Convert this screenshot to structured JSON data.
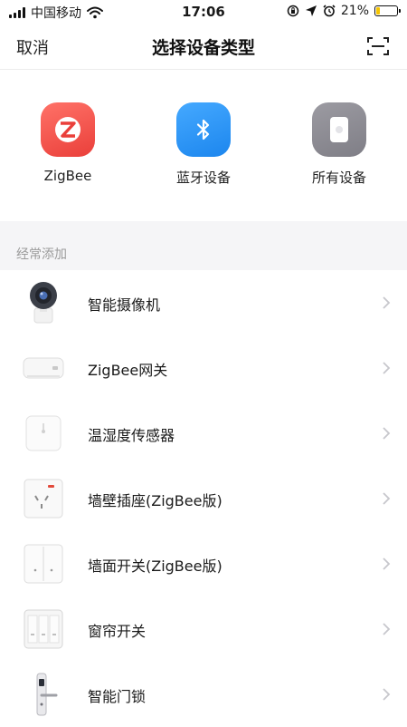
{
  "status_bar": {
    "carrier": "中国移动",
    "time": "17:06",
    "battery_percent": "21%",
    "battery_level": 0.21,
    "icons": [
      "signal-icon",
      "wifi-icon",
      "screen-rotation-lock-icon",
      "location-icon",
      "alarm-icon",
      "battery-icon"
    ]
  },
  "nav": {
    "cancel": "取消",
    "title": "选择设备类型",
    "scan_icon": "scan-icon"
  },
  "device_types": [
    {
      "label": "ZigBee",
      "icon": "zigbee-icon",
      "color": "#f0534a"
    },
    {
      "label": "蓝牙设备",
      "icon": "bluetooth-icon",
      "color": "#2c92f4"
    },
    {
      "label": "所有设备",
      "icon": "all-devices-icon",
      "color": "#8e8d94"
    }
  ],
  "section": {
    "title": "经常添加"
  },
  "devices": [
    {
      "label": "智能摄像机",
      "icon": "camera-icon"
    },
    {
      "label": "ZigBee网关",
      "icon": "gateway-icon"
    },
    {
      "label": "温湿度传感器",
      "icon": "sensor-icon"
    },
    {
      "label": "墙壁插座(ZigBee版)",
      "icon": "socket-icon"
    },
    {
      "label": "墙面开关(ZigBee版)",
      "icon": "switch-icon"
    },
    {
      "label": "窗帘开关",
      "icon": "curtain-switch-icon"
    },
    {
      "label": "智能门锁",
      "icon": "door-lock-icon"
    }
  ]
}
